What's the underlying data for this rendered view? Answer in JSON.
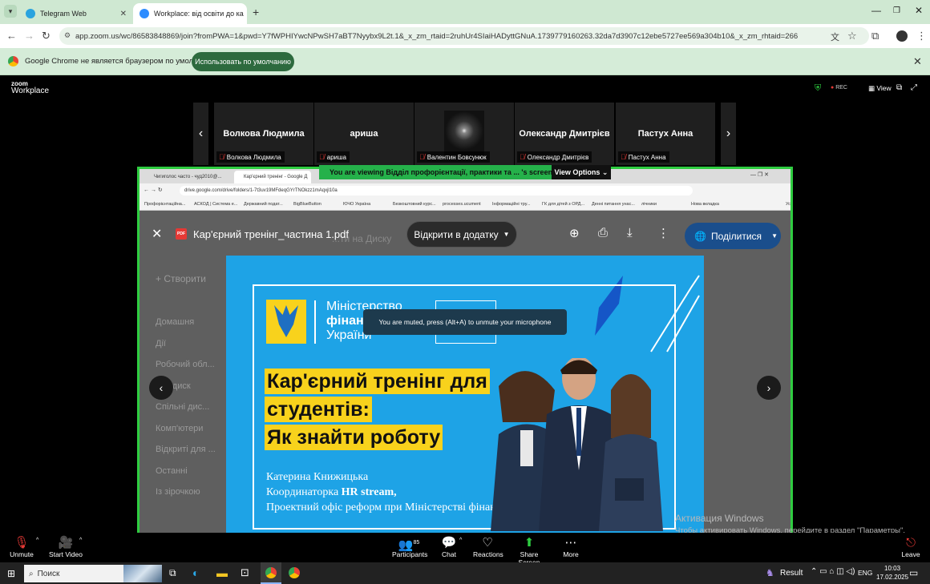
{
  "browser": {
    "tabs": [
      {
        "label": "Telegram Web",
        "color": "#2AA3DF"
      },
      {
        "label": "Workplace: від освіти до ка",
        "color": "#2D8CFF"
      }
    ],
    "url": "app.zoom.us/wc/86583848869/join?fromPWA=1&pwd=Y7fWPHIYwcNPwSH7aBT7Nyybx9L2t.1&_x_zm_rtaid=2ruhUr4SIaiHADyttGNuA.1739779160263.32da7d3907c12ebe5727ee569a304b10&_x_zm_rhtaid=266"
  },
  "infobar": {
    "message": "Google Chrome не является браузером по умолчанию.",
    "button": "Использовать по умолчанию"
  },
  "zoom": {
    "logo_top": "zoom",
    "logo_bottom": "Workplace",
    "rec": "REC",
    "view": "View",
    "participants": [
      {
        "name": "Волкова Людмила",
        "label": "Волкова Людмила"
      },
      {
        "name": "ариша",
        "label": "ариша"
      },
      {
        "name": "",
        "label": "Валентин Бовсунюк"
      },
      {
        "name": "Олександр Дмитрієв",
        "label": "Олександр Дмитрієв"
      },
      {
        "name": "Пастух Анна",
        "label": "Пастух Анна"
      }
    ],
    "viewing_banner": "You are viewing  Відділ профорієнтації, практики та ... 's screen",
    "view_options": "View Options",
    "muted_toast": "You are muted, press (Alt+A) to unmute your microphone",
    "toolbar": {
      "unmute": "Unmute",
      "start_video": "Start Video",
      "participants": "Participants",
      "participants_count": "85",
      "chat": "Chat",
      "reactions": "Reactions",
      "share_screen": "Share Screen",
      "more": "More",
      "leave": "Leave"
    }
  },
  "shared": {
    "tab1": "Чигиголос часто - чуд2010@...",
    "tab2": "Кар'єрний тренінг - Google Д",
    "url": "drive.google.com/drive/folders/1-7t3uv19MFdeqGYrTNOkzz1mAqxjl10a",
    "bookmarks": [
      "Профорієнтаційна...",
      "АСКОД | Система е...",
      "Державний подат...",
      "BigBlueButton",
      "ЮЧО Україна",
      "Безкоштовний курс...",
      "processes.ucument",
      "Інформаційні тру...",
      "ГК для дітей з ОРД...",
      "Денні питання унас...",
      "лічники",
      "Нова вкладка",
      "Усі закладки"
    ],
    "pdf_title": "Кар'єрний тренінг_частина 1.pdf",
    "open_with": "Відкрити в додатку",
    "share_btn": "Поділитися",
    "drive_bg": {
      "create": "Створити",
      "drive_items": [
        "Домашня",
        "Дії",
        "Робочий обл...",
        "Мій диск",
        "Спільні дис...",
        "Комп'ютери",
        "Відкриті для ...",
        "Останні",
        "Із зірочкою"
      ],
      "title": "...ти на Диску"
    },
    "slide": {
      "ministry_line1": "Міністерство",
      "ministry_line2": "фінансів",
      "ministry_line3": "України",
      "title_line1": "Кар'єрний тренінг для",
      "title_line2": "студентів:",
      "title_line3": "Як знайти роботу",
      "author": "Катерина Книжицька",
      "role_prefix": "Координаторка ",
      "role_bold": "HR stream,",
      "office": "Проектний офіс реформ при Міністерстві фінансів України"
    }
  },
  "windows": {
    "watermark_title": "Активация Windows",
    "watermark_text": "Чтобы активировать Windows, перейдите в раздел \"Параметры\".",
    "search": "Поиск",
    "result": "Result",
    "lang": "ENG",
    "time": "10:03",
    "date": "17.02.2025"
  },
  "colors": {
    "chrome_green": "#cfe8d2",
    "share_border": "#2ecc40",
    "slide_blue": "#1ea3e6",
    "highlight_yellow": "#f8d21c"
  }
}
